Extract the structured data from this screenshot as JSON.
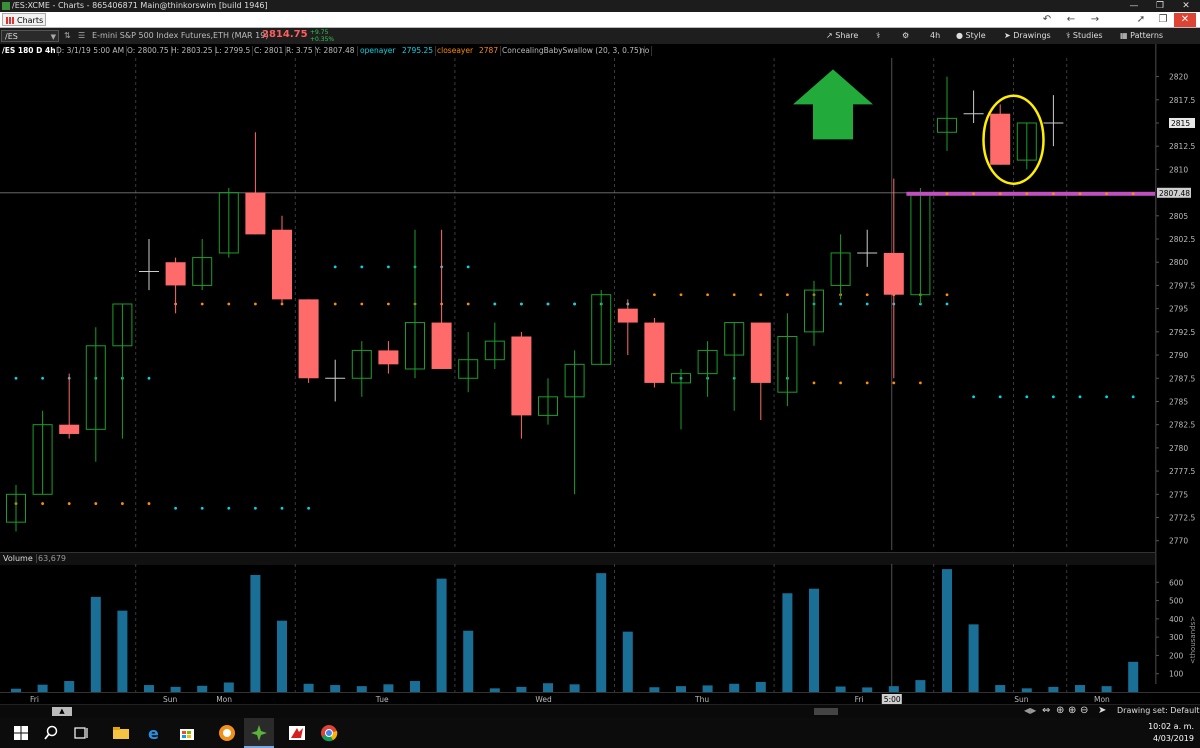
{
  "window": {
    "title": "/ES:XCME - Charts - 865406871 Main@thinkorswim [build 1946]"
  },
  "tabs": {
    "charts_label": "Charts"
  },
  "symbol_bar": {
    "symbol": "/ES",
    "description": "E-mini S&P 500 Index Futures,ETH (MAR 19)",
    "last_price": "2814.75",
    "change": "+9.75",
    "change_pct": "+0.35%",
    "share_label": "Share",
    "timeframe_label": "4h",
    "style_label": "Style",
    "drawings_label": "Drawings",
    "studies_label": "Studies",
    "patterns_label": "Patterns"
  },
  "info_bar": {
    "chart_id": "/ES 180 D 4h",
    "date": "D: 3/1/19 5:00 AM",
    "open": "O: 2800.75",
    "high": "H: 2803.25",
    "low": "L: 2799.5",
    "close": "C: 2801",
    "range": "R: 3.75",
    "y": "Y: 2807.48",
    "openayer_label": "openayer",
    "openayer_value": "2795.25",
    "closeayer_label": "closeayer",
    "closeayer_value": "2787",
    "study_label": "ConcealingBabySwallow (20, 3, 0.75)",
    "study_flag": "no"
  },
  "price_axis": {
    "ticks": [
      "2820",
      "2817.5",
      "2815",
      "2812.5",
      "2810",
      "2807.48",
      "2805",
      "2802.5",
      "2800",
      "2797.5",
      "2795",
      "2792.5",
      "2790",
      "2787.5",
      "2785",
      "2782.5",
      "2780",
      "2777.5",
      "2775",
      "2772.5",
      "2770"
    ],
    "current_price_label": "2815",
    "crosshair_price_label": "2807.48"
  },
  "volume": {
    "label": "Volume",
    "value": "63,679",
    "axis_ticks": [
      "600",
      "500",
      "400",
      "300",
      "200",
      "100"
    ],
    "axis_unit": "<thousands>"
  },
  "time_axis": {
    "labels": [
      "Fri",
      "Sun",
      "Mon",
      "Tue",
      "Wed",
      "Thu",
      "Fri",
      "Sun",
      "Mon"
    ],
    "crosshair_time": "5:00"
  },
  "status": {
    "drawing_set": "Drawing set: Default"
  },
  "clock": {
    "time": "10:02 a. m.",
    "date": "4/03/2019"
  },
  "colors": {
    "up_candle": "#1a9e2a",
    "down_candle": "#ff6b6b",
    "volume_bar": "#1a6f96",
    "highlight_circle": "#ffee00",
    "arrow": "#22aa3a",
    "level_line": "#c050c0",
    "openayer_dots": "#ff8c00",
    "closeayer_dots": "#00d8e8"
  },
  "chart_data": [
    {
      "type": "candlestick",
      "title": "/ES 180 D 4h",
      "ylim": [
        2769,
        2822
      ],
      "categories": [
        "Fri",
        "",
        "",
        "",
        "",
        "Sun",
        "",
        "",
        "",
        "",
        "",
        "Mon",
        "",
        "",
        "",
        "",
        "",
        "Tue",
        "",
        "",
        "",
        "",
        "",
        "Wed",
        "",
        "",
        "",
        "",
        "",
        "Thu",
        "",
        "",
        "",
        "",
        "",
        "Fri",
        "",
        "",
        "",
        "",
        "",
        "Sun",
        "",
        "",
        "Mon",
        "",
        ""
      ],
      "candles": [
        {
          "o": 2772,
          "h": 2776,
          "l": 2771,
          "c": 2775,
          "dir": "up"
        },
        {
          "o": 2775,
          "h": 2784,
          "l": 2775,
          "c": 2782.5,
          "dir": "up"
        },
        {
          "o": 2782.5,
          "h": 2788,
          "l": 2781,
          "c": 2781.5,
          "dir": "down"
        },
        {
          "o": 2782,
          "h": 2793,
          "l": 2778.5,
          "c": 2791,
          "dir": "up"
        },
        {
          "o": 2791,
          "h": 2795.5,
          "l": 2781,
          "c": 2795.5,
          "dir": "up"
        },
        {
          "o": 2799,
          "h": 2802.5,
          "l": 2797,
          "c": 2799,
          "dir": "flat"
        },
        {
          "o": 2800,
          "h": 2800.5,
          "l": 2794.5,
          "c": 2797.5,
          "dir": "down"
        },
        {
          "o": 2797.5,
          "h": 2802.5,
          "l": 2797,
          "c": 2800.5,
          "dir": "up"
        },
        {
          "o": 2801,
          "h": 2808,
          "l": 2800.5,
          "c": 2807.5,
          "dir": "up"
        },
        {
          "o": 2807.5,
          "h": 2814,
          "l": 2803,
          "c": 2803,
          "dir": "down"
        },
        {
          "o": 2803.5,
          "h": 2805,
          "l": 2795.5,
          "c": 2796,
          "dir": "down"
        },
        {
          "o": 2796,
          "h": 2796,
          "l": 2787,
          "c": 2787.5,
          "dir": "down"
        },
        {
          "o": 2788,
          "h": 2789.5,
          "l": 2785,
          "c": 2787.5,
          "dir": "flat"
        },
        {
          "o": 2787.5,
          "h": 2791.5,
          "l": 2785.5,
          "c": 2790.5,
          "dir": "up"
        },
        {
          "o": 2790.5,
          "h": 2791.5,
          "l": 2788,
          "c": 2789,
          "dir": "down"
        },
        {
          "o": 2788.5,
          "h": 2803.5,
          "l": 2787.5,
          "c": 2793.5,
          "dir": "up"
        },
        {
          "o": 2793.5,
          "h": 2803.5,
          "l": 2788.5,
          "c": 2788.5,
          "dir": "down"
        },
        {
          "o": 2787.5,
          "h": 2792.5,
          "l": 2786,
          "c": 2789.5,
          "dir": "up"
        },
        {
          "o": 2789.5,
          "h": 2793.5,
          "l": 2788.5,
          "c": 2791.5,
          "dir": "up"
        },
        {
          "o": 2792,
          "h": 2792.5,
          "l": 2781,
          "c": 2783.5,
          "dir": "down"
        },
        {
          "o": 2783.5,
          "h": 2787.5,
          "l": 2782.5,
          "c": 2785.5,
          "dir": "up"
        },
        {
          "o": 2785.5,
          "h": 2790.5,
          "l": 2775,
          "c": 2789,
          "dir": "up"
        },
        {
          "o": 2789,
          "h": 2797,
          "l": 2789,
          "c": 2796.5,
          "dir": "up"
        },
        {
          "o": 2795,
          "h": 2796,
          "l": 2790,
          "c": 2793.5,
          "dir": "down"
        },
        {
          "o": 2793.5,
          "h": 2794,
          "l": 2786.5,
          "c": 2787,
          "dir": "down"
        },
        {
          "o": 2787,
          "h": 2788.5,
          "l": 2782,
          "c": 2788,
          "dir": "up"
        },
        {
          "o": 2788,
          "h": 2791.5,
          "l": 2785.5,
          "c": 2790.5,
          "dir": "up"
        },
        {
          "o": 2790,
          "h": 2793.5,
          "l": 2784,
          "c": 2793.5,
          "dir": "up"
        },
        {
          "o": 2793.5,
          "h": 2793.5,
          "l": 2783,
          "c": 2787,
          "dir": "down"
        },
        {
          "o": 2786,
          "h": 2794.5,
          "l": 2784.5,
          "c": 2792,
          "dir": "up"
        },
        {
          "o": 2792.5,
          "h": 2798,
          "l": 2791,
          "c": 2797,
          "dir": "up"
        },
        {
          "o": 2797.5,
          "h": 2803,
          "l": 2796,
          "c": 2801,
          "dir": "up"
        },
        {
          "o": 2801,
          "h": 2803.5,
          "l": 2799.5,
          "c": 2801,
          "dir": "flat"
        },
        {
          "o": 2801,
          "h": 2809,
          "l": 2787.5,
          "c": 2796.5,
          "dir": "down"
        },
        {
          "o": 2796.5,
          "h": 2808,
          "l": 2795.5,
          "c": 2807.5,
          "dir": "up"
        },
        {
          "o": 2814,
          "h": 2820,
          "l": 2812,
          "c": 2815.5,
          "dir": "up"
        },
        {
          "o": 2816,
          "h": 2818.5,
          "l": 2815,
          "c": 2816,
          "dir": "flat"
        },
        {
          "o": 2816,
          "h": 2817,
          "l": 2810.5,
          "c": 2810.5,
          "dir": "down"
        },
        {
          "o": 2811,
          "h": 2815,
          "l": 2810,
          "c": 2815,
          "dir": "up"
        },
        {
          "o": 2815,
          "h": 2818,
          "l": 2812.5,
          "c": 2815,
          "dir": "flat"
        }
      ],
      "openayer_levels": [
        {
          "from": 0,
          "to": 5,
          "value": 2774
        },
        {
          "from": 6,
          "to": 11,
          "value": 2795.5
        },
        {
          "from": 12,
          "to": 17,
          "value": 2795.5
        },
        {
          "from": 18,
          "to": 23,
          "value": 2795.5
        },
        {
          "from": 24,
          "to": 29,
          "value": 2796.5
        },
        {
          "from": 30,
          "to": 35,
          "value": 2796.5
        },
        {
          "from": 30,
          "to": 34,
          "value": 2787
        },
        {
          "from": 35,
          "to": 43,
          "value": 2807.48
        }
      ],
      "closeayer_levels": [
        {
          "from": 0,
          "to": 5,
          "value": 2787.5
        },
        {
          "from": 6,
          "to": 11,
          "value": 2773.5
        },
        {
          "from": 12,
          "to": 17,
          "value": 2799.5
        },
        {
          "from": 18,
          "to": 23,
          "value": 2795.5
        },
        {
          "from": 24,
          "to": 29,
          "value": 2787.5
        },
        {
          "from": 30,
          "to": 35,
          "value": 2795.5
        },
        {
          "from": 36,
          "to": 43,
          "value": 2785.5
        }
      ],
      "horizontal_level": 2807.48
    },
    {
      "type": "bar",
      "title": "Volume",
      "unit": "thousands",
      "ylim": [
        0,
        700
      ],
      "values": [
        18,
        40,
        60,
        520,
        445,
        38,
        28,
        34,
        52,
        640,
        390,
        45,
        38,
        32,
        42,
        60,
        620,
        335,
        20,
        28,
        48,
        42,
        650,
        330,
        26,
        32,
        36,
        45,
        55,
        540,
        565,
        30,
        25,
        32,
        65,
        672,
        370,
        38,
        20,
        28,
        38,
        32,
        165
      ]
    }
  ]
}
